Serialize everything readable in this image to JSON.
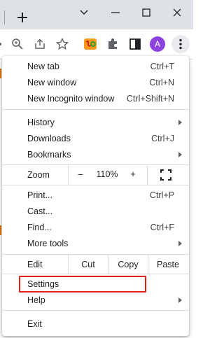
{
  "avatar_letter": "A",
  "menu": {
    "group1": [
      {
        "label": "New tab",
        "shortcut": "Ctrl+T"
      },
      {
        "label": "New window",
        "shortcut": "Ctrl+N"
      },
      {
        "label": "New Incognito window",
        "shortcut": "Ctrl+Shift+N"
      }
    ],
    "group2": [
      {
        "label": "History",
        "submenu": true
      },
      {
        "label": "Downloads",
        "shortcut": "Ctrl+J"
      },
      {
        "label": "Bookmarks",
        "submenu": true
      }
    ],
    "zoom": {
      "label": "Zoom",
      "minus": "–",
      "value": "110%",
      "plus": "+"
    },
    "group3": [
      {
        "label": "Print...",
        "shortcut": "Ctrl+P"
      },
      {
        "label": "Cast..."
      },
      {
        "label": "Find...",
        "shortcut": "Ctrl+F"
      },
      {
        "label": "More tools",
        "submenu": true
      }
    ],
    "edit": {
      "label": "Edit",
      "cut": "Cut",
      "copy": "Copy",
      "paste": "Paste"
    },
    "settings": "Settings",
    "help": "Help",
    "exit": "Exit"
  },
  "colors": {
    "highlight": "#e0201b",
    "avatar": "#8c43dd"
  }
}
